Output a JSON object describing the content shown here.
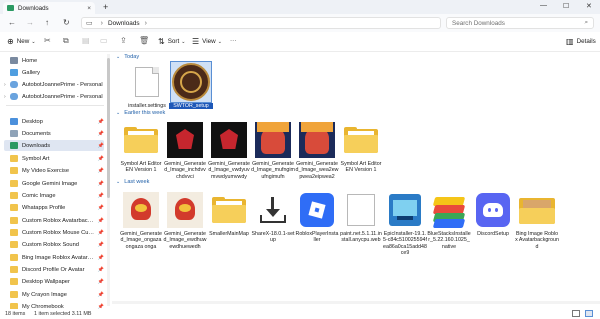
{
  "window": {
    "tab_title": "Downloads",
    "tab_close": "×",
    "new_tab": "+",
    "minimize": "—",
    "maximize": "☐",
    "close": "✕"
  },
  "nav": {
    "back": "←",
    "forward": "→",
    "up": "↑",
    "refresh": "↻",
    "breadcrumb": "Downloads",
    "search_placeholder": "Search Downloads"
  },
  "command_bar": {
    "new_label": "New",
    "sort_label": "Sort",
    "view_label": "View",
    "more_label": "···",
    "details_label": "Details"
  },
  "sidebar": {
    "items": [
      {
        "label": "Home",
        "icon": "home-icon",
        "pinned": false,
        "expand": false
      },
      {
        "label": "Gallery",
        "icon": "gallery-icon",
        "pinned": false,
        "expand": false
      },
      {
        "label": "AutobotJoannePrime - Personal",
        "icon": "onedrive-icon",
        "pinned": false,
        "expand": true
      },
      {
        "label": "AutobotJoannePrime - Personal",
        "icon": "onedrive-icon",
        "pinned": false,
        "expand": true
      },
      {
        "label": "Desktop",
        "icon": "desktop-icon",
        "pinned": true,
        "expand": false
      },
      {
        "label": "Documents",
        "icon": "documents-icon",
        "pinned": true,
        "expand": false
      },
      {
        "label": "Downloads",
        "icon": "downloads-icon",
        "pinned": true,
        "expand": false,
        "selected": true
      },
      {
        "label": "Symbol Art",
        "icon": "folder-icon",
        "pinned": true,
        "expand": false
      },
      {
        "label": "My Video Exercise",
        "icon": "folder-icon",
        "pinned": true,
        "expand": false
      },
      {
        "label": "Google Gemini Image",
        "icon": "folder-icon",
        "pinned": true,
        "expand": false
      },
      {
        "label": "Comic Image",
        "icon": "folder-icon",
        "pinned": true,
        "expand": false
      },
      {
        "label": "Whatapps Profile",
        "icon": "folder-icon",
        "pinned": true,
        "expand": false
      },
      {
        "label": "Custom Roblox Avatarbackground",
        "icon": "folder-icon",
        "pinned": true,
        "expand": false
      },
      {
        "label": "Custom Roblox Mouse Cursor",
        "icon": "folder-icon",
        "pinned": true,
        "expand": false
      },
      {
        "label": "Custom Roblox Sound",
        "icon": "folder-icon",
        "pinned": true,
        "expand": false
      },
      {
        "label": "Bing Image Roblox Avatarbackground",
        "icon": "folder-icon",
        "pinned": true,
        "expand": false
      },
      {
        "label": "Discord Profile Or Avatar",
        "icon": "folder-icon",
        "pinned": true,
        "expand": false
      },
      {
        "label": "Desktop Wallpaper",
        "icon": "folder-icon",
        "pinned": true,
        "expand": false
      },
      {
        "label": "My Crayon Image",
        "icon": "folder-icon",
        "pinned": true,
        "expand": false
      },
      {
        "label": "My Chromebook",
        "icon": "folder-icon",
        "pinned": true,
        "expand": false
      }
    ]
  },
  "groups": [
    {
      "header": "Today",
      "items": [
        {
          "name": "installer.settings",
          "kind": "file"
        },
        {
          "name": "SWTOR_setup",
          "kind": "swtor",
          "selected": true
        }
      ]
    },
    {
      "header": "Earlier this week",
      "items": [
        {
          "name": "Symbol Art Editor EN Version 1",
          "kind": "folder"
        },
        {
          "name": "Gemini_Generated_Image_inchdvvchdvvci",
          "kind": "img-robot"
        },
        {
          "name": "Gemini_Generated_Image_vwdyuvmvwdyumvwdy",
          "kind": "img-robot"
        },
        {
          "name": "Gemini_Generated_Image_mufngimufngimufn",
          "kind": "img-blue"
        },
        {
          "name": "Gemini_Generated_Image_wea2ewpwea2eipwea2",
          "kind": "img-blue"
        },
        {
          "name": "Symbol Art Editor EN Version 1",
          "kind": "folder"
        }
      ]
    },
    {
      "header": "Last week",
      "items": [
        {
          "name": "Gemini_Generated_Image_ongaza ongaza onga",
          "kind": "img-toon"
        },
        {
          "name": "Gemini_Generated_Image_ewdhuwewdhuewedh",
          "kind": "img-toon"
        },
        {
          "name": "SmallerMainMap",
          "kind": "folder"
        },
        {
          "name": "ShareX-18.0.1-setup",
          "kind": "download"
        },
        {
          "name": "RobloxPlayerInstaller",
          "kind": "roblox"
        },
        {
          "name": "paint.net.5.1.11.install.anycpu.web",
          "kind": "paint"
        },
        {
          "name": "EpicInstaller-19.1.5-c84c510025594fea86a0ca15add48ce9",
          "kind": "epic"
        },
        {
          "name": "BlueStacksInstaller_5.22.160.1025_native",
          "kind": "bluestacks"
        },
        {
          "name": "DiscordSetup",
          "kind": "discord"
        },
        {
          "name": "Bing Image Roblox Avatarbackground",
          "kind": "folder-img"
        }
      ]
    }
  ],
  "status": {
    "item_count": "18 items",
    "selection": "1 item selected  3.11 MB"
  },
  "colors": {
    "accent": "#1e58b8",
    "selected_bg": "#dfe6f2",
    "folder": "#f6cf5a"
  }
}
